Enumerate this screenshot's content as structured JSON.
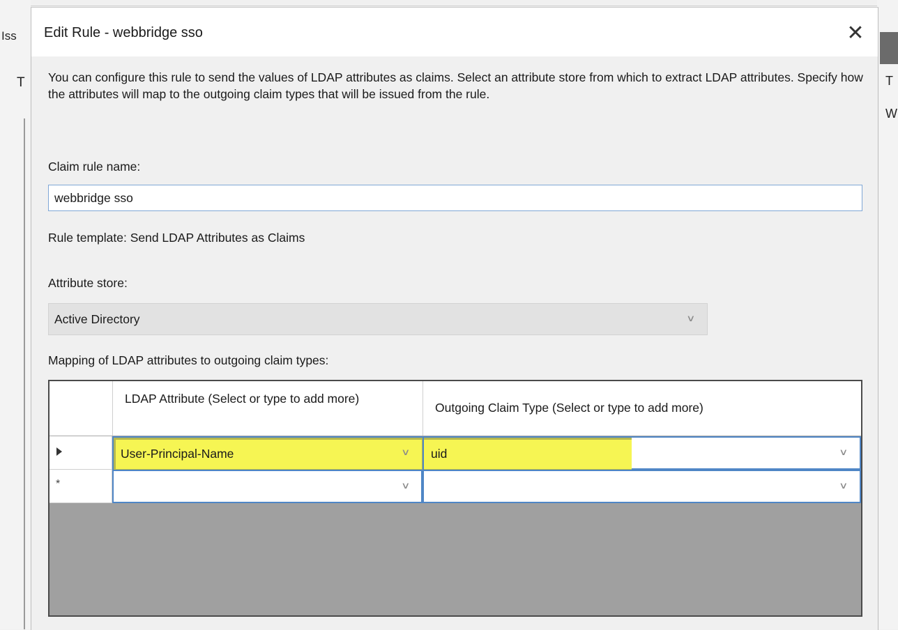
{
  "background_window": {
    "left_fragment_1": "Iss",
    "left_fragment_2": "T",
    "right_fragment_1": "T",
    "right_fragment_2": "W"
  },
  "dialog": {
    "title": "Edit Rule - webbridge sso",
    "close_glyph": "✕",
    "description": "You can configure this rule to send the values of LDAP attributes as claims. Select an attribute store from which to extract LDAP attributes. Specify how the attributes will map to the outgoing claim types that will be issued from the rule.",
    "claim_rule_name_label": "Claim rule name:",
    "claim_rule_name_value": "webbridge sso",
    "rule_template_text": "Rule template: Send LDAP Attributes as Claims",
    "attribute_store_label": "Attribute store:",
    "attribute_store_value": "Active Directory",
    "mapping_label": "Mapping of LDAP attributes to outgoing claim types:",
    "grid": {
      "columns": [
        "LDAP Attribute (Select or type to add more)",
        "Outgoing Claim Type (Select or type to add more)"
      ],
      "rows": [
        {
          "marker": "pointer",
          "ldap_attribute": "User-Principal-Name",
          "outgoing_claim_type": "uid",
          "highlighted": true
        },
        {
          "marker": "*",
          "ldap_attribute": "",
          "outgoing_claim_type": "",
          "highlighted": false
        }
      ]
    },
    "chevron_glyph": "∨",
    "highlight_color": "#f6f553"
  }
}
